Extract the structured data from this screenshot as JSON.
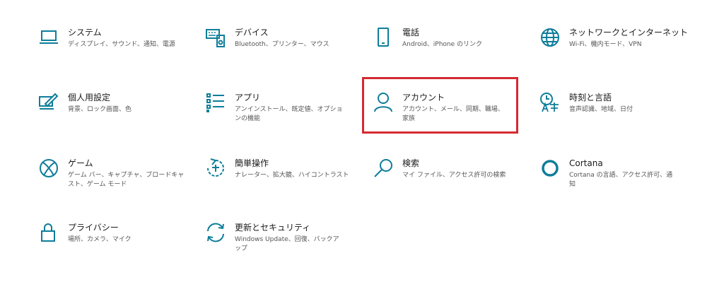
{
  "accent": "#0e7d9a",
  "highlight_color": "#d42a32",
  "tiles": [
    {
      "title": "システム",
      "desc": "ディスプレイ、サウンド、通知、電源",
      "icon": "laptop-icon"
    },
    {
      "title": "デバイス",
      "desc": "Bluetooth、プリンター、マウス",
      "icon": "keyboard-speaker-icon"
    },
    {
      "title": "電話",
      "desc": "Android、iPhone のリンク",
      "icon": "phone-icon"
    },
    {
      "title": "ネットワークとインターネット",
      "desc": "Wi-Fi、機内モード、VPN",
      "icon": "globe-icon"
    },
    {
      "title": "個人用設定",
      "desc": "背景、ロック画面、色",
      "icon": "pen-screen-icon"
    },
    {
      "title": "アプリ",
      "desc": "アンインストール、既定値、オプションの機能",
      "icon": "apps-list-icon"
    },
    {
      "title": "アカウント",
      "desc": "アカウント、メール、同期、職場、家族",
      "icon": "person-icon"
    },
    {
      "title": "時刻と言語",
      "desc": "音声認識、地域、日付",
      "icon": "time-language-icon"
    },
    {
      "title": "ゲーム",
      "desc": "ゲーム バー、キャプチャ、ブロードキャスト、ゲーム モード",
      "icon": "xbox-icon"
    },
    {
      "title": "簡単操作",
      "desc": "ナレーター、拡大鏡、ハイコントラスト",
      "icon": "ease-of-access-icon"
    },
    {
      "title": "検索",
      "desc": "マイ ファイル、アクセス許可の検索",
      "icon": "search-icon"
    },
    {
      "title": "Cortana",
      "desc": "Cortana の言語、アクセス許可、通知",
      "icon": "cortana-icon"
    },
    {
      "title": "プライバシー",
      "desc": "場所、カメラ、マイク",
      "icon": "lock-icon"
    },
    {
      "title": "更新とセキュリティ",
      "desc": "Windows Update、回復、バックアップ",
      "icon": "sync-icon"
    }
  ]
}
